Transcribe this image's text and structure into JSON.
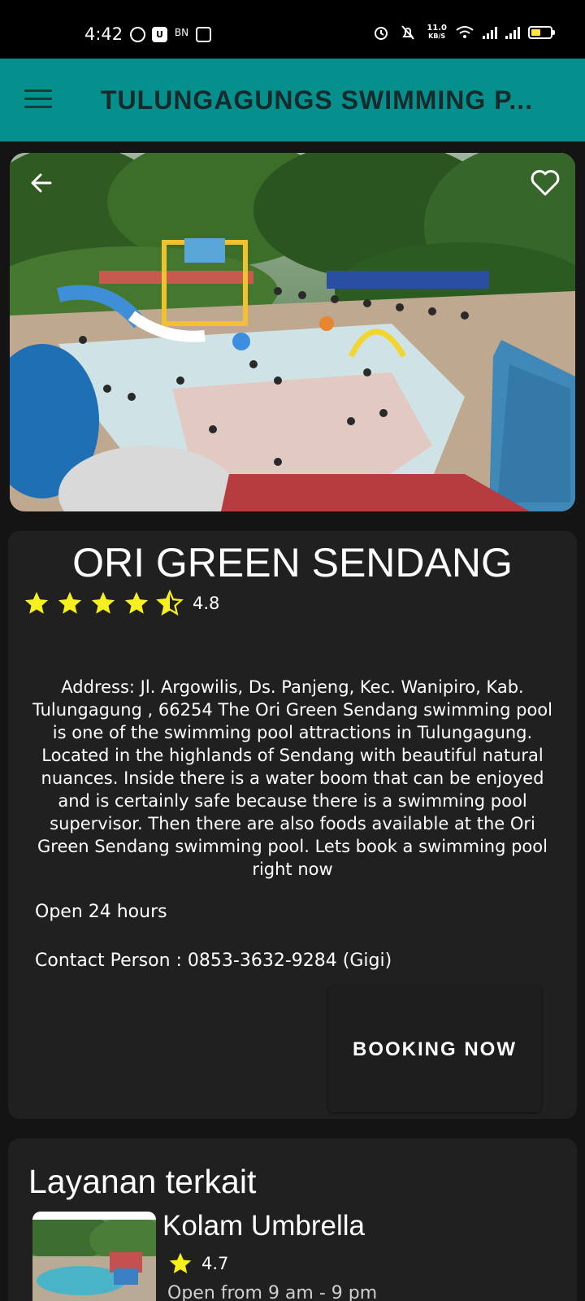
{
  "status_bar": {
    "time": "4:42",
    "left_icons": [
      "whatsapp-icon",
      "u-app-icon",
      "bni-icon",
      "instagram-icon"
    ],
    "net_speed_value": "11.0",
    "net_speed_unit": "KB/S",
    "right_icons": [
      "alarm-icon",
      "mute-icon",
      "wifi-icon",
      "signal-icon",
      "signal-icon",
      "battery-icon"
    ]
  },
  "app_bar": {
    "title": "TULUNGAGUNGS SWIMMING P...",
    "background": "#05908e"
  },
  "hero": {
    "image_alt_icon": "waterpark-photo",
    "back_icon": "arrow-left-icon",
    "favorite_icon": "heart-outline-icon"
  },
  "detail": {
    "name": "ORI GREEN SENDANG",
    "rating_stars": 4.5,
    "rating_value": "4.8",
    "description": "Address: Jl. Argowilis, Ds. Panjeng, Kec. Wanipiro, Kab. Tulungagung , 66254 The Ori Green Sendang swimming pool is one of the swimming pool attractions in Tulungagung. Located in the highlands of Sendang with beautiful natural nuances. Inside there is a water boom that can be enjoyed and is certainly safe because there is a swimming pool supervisor. Then there are also foods available at the Ori Green Sendang swimming pool. Lets book a swimming pool right now",
    "hours": "Open 24 hours",
    "contact": "Contact Person : 0853-3632-9284 (Gigi)",
    "booking_label": "BOOKING NOW",
    "star_color": "#f7f01f"
  },
  "related": {
    "title": "Layanan terkait",
    "items": [
      {
        "name": "Kolam Umbrella",
        "rating_value": "4.7",
        "hours": "Open from 9 am - 9 pm"
      }
    ]
  }
}
